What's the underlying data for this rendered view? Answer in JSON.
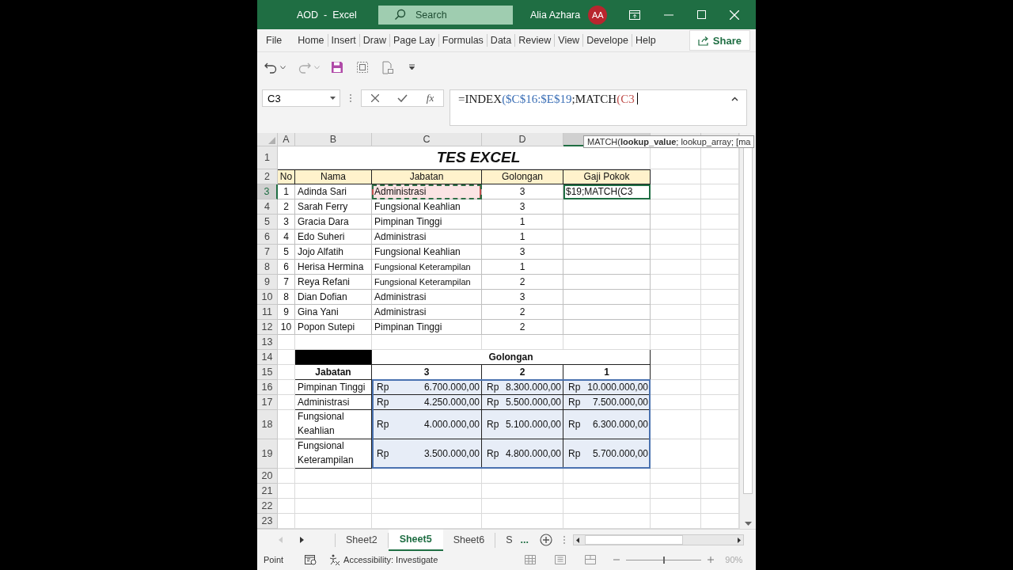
{
  "window": {
    "title": "AOD  -  Excel"
  },
  "search": {
    "placeholder": "Search"
  },
  "user": {
    "name": "Alia Azhara",
    "initials": "AA"
  },
  "menu": [
    "File",
    "Home",
    "Insert",
    "Draw",
    "Page Lay",
    "Formulas",
    "Data",
    "Review",
    "View",
    "Develope",
    "Help"
  ],
  "share": "Share",
  "name_box": "C3",
  "fx": "fx",
  "formula": [
    {
      "text": "=INDEX",
      "color": "#1a1a1a"
    },
    {
      "text": "($C$16:$E$19",
      "color": "#3b6fb6"
    },
    {
      "text": ";MATCH",
      "color": "#1a1a1a"
    },
    {
      "text": "(C3",
      "color": "#c0504d"
    }
  ],
  "tooltip": "MATCH(**lookup_value**; lookup_array; [ma",
  "columns": [
    {
      "label": "A",
      "selected": false
    },
    {
      "label": "B",
      "selected": false
    },
    {
      "label": "C",
      "selected": false
    },
    {
      "label": "D",
      "selected": false
    },
    {
      "selected": true
    },
    {
      "selected": false
    },
    {
      "selected": false
    }
  ],
  "row_headers": [
    {
      "label": "1",
      "selected": false
    },
    {
      "label": "2",
      "selected": false
    },
    {
      "label": "3",
      "selected": true
    },
    {
      "label": "4",
      "selected": false
    },
    {
      "label": "5",
      "selected": false
    },
    {
      "label": "6",
      "selected": false
    },
    {
      "label": "7",
      "selected": false
    },
    {
      "label": "8",
      "selected": false
    },
    {
      "label": "9",
      "selected": false
    },
    {
      "label": "10",
      "selected": false
    },
    {
      "label": "11",
      "selected": false
    },
    {
      "label": "12",
      "selected": false
    },
    {
      "label": "13",
      "selected": false
    },
    {
      "label": "14",
      "selected": false
    },
    {
      "label": "15",
      "selected": false
    },
    {
      "label": "16",
      "selected": false
    },
    {
      "label": "17",
      "selected": false
    },
    {
      "label": "18",
      "selected": false
    },
    {
      "label": "19",
      "selected": false
    },
    {
      "label": "20",
      "selected": false
    },
    {
      "label": "21",
      "selected": false
    },
    {
      "label": "22",
      "selected": false
    },
    {
      "label": "23",
      "selected": false
    }
  ],
  "sheet_title": "TES EXCEL",
  "table1": {
    "headers": [
      "No",
      "Nama",
      "Jabatan",
      "Golongan",
      "Gaji Pokok"
    ],
    "rows": [
      {
        "no": "1",
        "nama": "Adinda Sari",
        "jabatan": "Administrasi",
        "golongan": "3",
        "gaji": "$19;MATCH(C3",
        "referenced": true,
        "active": true
      },
      {
        "no": "2",
        "nama": "Sarah Ferry",
        "jabatan": "Fungsional Keahlian",
        "golongan": "3",
        "referenced": false,
        "active": false
      },
      {
        "no": "3",
        "nama": "Gracia Dara",
        "jabatan": "Pimpinan Tinggi",
        "golongan": "1",
        "referenced": false,
        "active": false
      },
      {
        "no": "4",
        "nama": "Edo Suheri",
        "jabatan": "Administrasi",
        "golongan": "1",
        "referenced": false,
        "active": false
      },
      {
        "no": "5",
        "nama": "Jojo Alfatih",
        "jabatan": "Fungsional Keahlian",
        "golongan": "3",
        "referenced": false,
        "active": false
      },
      {
        "no": "6",
        "nama": "Herisa Hermina",
        "jabatan": "Fungsional Keterampilan",
        "golongan": "1",
        "referenced": false,
        "active": false
      },
      {
        "no": "7",
        "nama": "Reya Refani",
        "jabatan": "Fungsional Keterampilan",
        "golongan": "2",
        "referenced": false,
        "active": false
      },
      {
        "no": "8",
        "nama": "Dian Dofian",
        "jabatan": "Administrasi",
        "golongan": "3",
        "referenced": false,
        "active": false
      },
      {
        "no": "9",
        "nama": "Gina Yani",
        "jabatan": "Administrasi",
        "golongan": "2",
        "referenced": false,
        "active": false
      },
      {
        "no": "10",
        "nama": "Popon Sutepi",
        "jabatan": "Pimpinan Tinggi",
        "golongan": "2",
        "referenced": false,
        "active": false
      }
    ]
  },
  "table2": {
    "group_header": "Golongan",
    "row_header": "Jabatan",
    "columns": [
      "3",
      "2",
      "1"
    ],
    "range_selected": true,
    "rows": [
      {
        "jabatan": "Pimpinan Tinggi",
        "values": [
          {
            "currency": "Rp",
            "amount": "6.700.000,00"
          },
          {
            "currency": "Rp",
            "amount": "8.300.000,00"
          },
          {
            "currency": "Rp",
            "amount": "10.000.000,00"
          }
        ]
      },
      {
        "jabatan": "Administrasi",
        "values": [
          {
            "currency": "Rp",
            "amount": "4.250.000,00"
          },
          {
            "currency": "Rp",
            "amount": "5.500.000,00"
          },
          {
            "currency": "Rp",
            "amount": "7.500.000,00"
          }
        ]
      },
      {
        "jabatan": "Fungsional Keahlian",
        "values": [
          {
            "currency": "Rp",
            "amount": "4.000.000,00"
          },
          {
            "currency": "Rp",
            "amount": "5.100.000,00"
          },
          {
            "currency": "Rp",
            "amount": "6.300.000,00"
          }
        ]
      },
      {
        "jabatan": "Fungsional Keterampilan",
        "values": [
          {
            "currency": "Rp",
            "amount": "3.500.000,00"
          },
          {
            "currency": "Rp",
            "amount": "4.800.000,00"
          },
          {
            "currency": "Rp",
            "amount": "5.700.000,00"
          }
        ]
      }
    ]
  },
  "sheet_tabs": [
    {
      "label": "Sheet2",
      "selected": false
    },
    {
      "label": "Sheet5",
      "selected": true
    },
    {
      "label": "Sheet6",
      "selected": false
    },
    {
      "label": "S",
      "selected": false
    }
  ],
  "more_tabs": "...",
  "status": {
    "mode": "Point",
    "accessibility": "Accessibility: Investigate",
    "zoom": "90%",
    "zoom_slider": {
      "level": 0.5
    }
  }
}
